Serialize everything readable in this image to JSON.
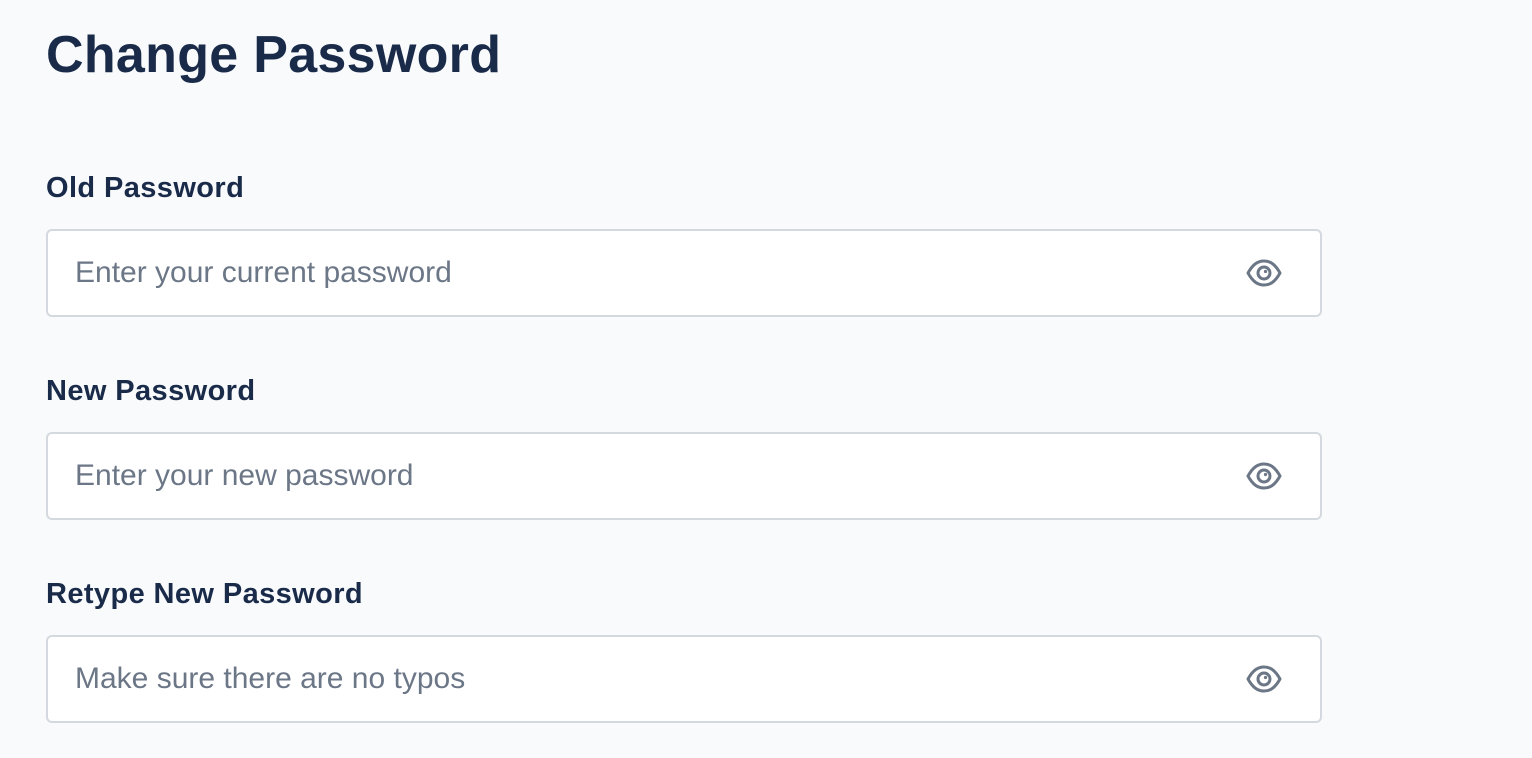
{
  "page": {
    "title": "Change Password"
  },
  "form": {
    "fields": [
      {
        "label": "Old Password",
        "value": "",
        "placeholder": "Enter your current password",
        "icon": "eye-icon"
      },
      {
        "label": "New Password",
        "value": "",
        "placeholder": "Enter your new password",
        "icon": "eye-icon"
      },
      {
        "label": "Retype New Password",
        "value": "",
        "placeholder": "Make sure there are no typos",
        "icon": "eye-icon"
      }
    ]
  },
  "colors": {
    "background": "#f8fafc",
    "heading": "#1a2b4a",
    "placeholder": "#6b7686",
    "input_border": "#d4d9e0",
    "icon": "#6b7686"
  }
}
